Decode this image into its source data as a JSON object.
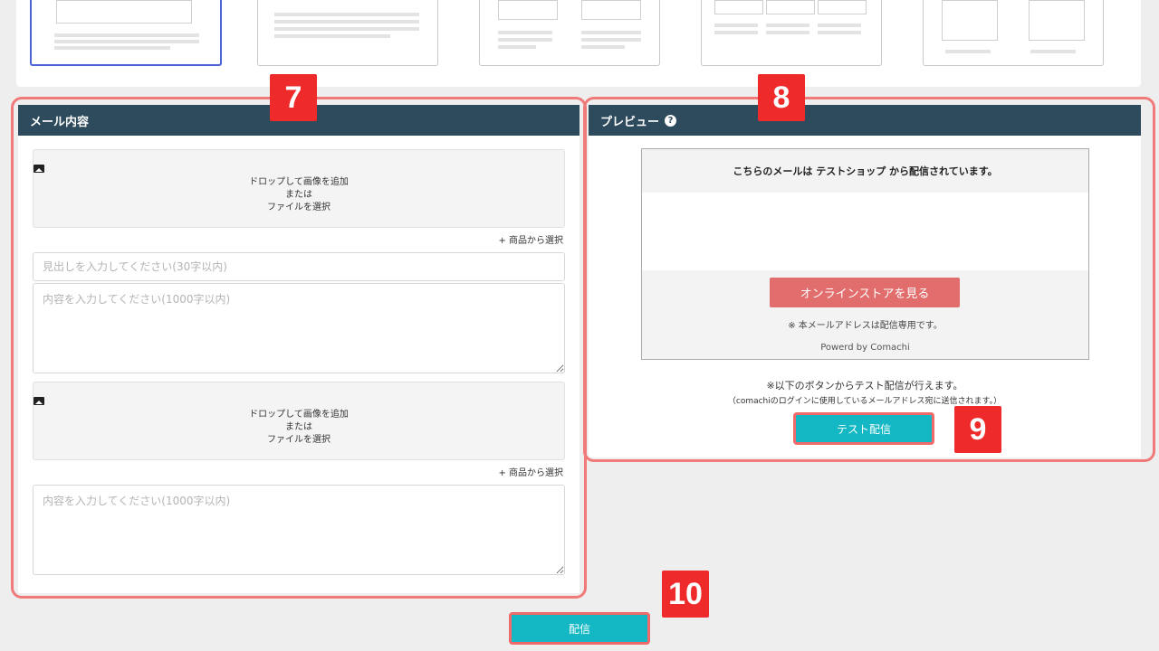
{
  "templates": [
    {
      "name": "template-1",
      "selected": true
    },
    {
      "name": "template-2",
      "selected": false
    },
    {
      "name": "template-3",
      "selected": false
    },
    {
      "name": "template-4",
      "selected": false
    },
    {
      "name": "template-5",
      "selected": false
    }
  ],
  "mail_panel": {
    "title": "メール内容",
    "drop_line1": "ドロップして画像を追加",
    "drop_line2": "または",
    "drop_line3": "ファイルを選択",
    "pick_product": "+ 商品から選択",
    "headline_placeholder": "見出しを入力してください(30字以内)",
    "content_placeholder": "内容を入力してください(1000字以内)"
  },
  "preview_panel": {
    "title": "プレビュー",
    "sender_text": "こちらのメールは テストショップ から配信されています。",
    "store_button": "オンラインストアを見る",
    "note": "※ 本メールアドレスは配信専用です。",
    "powered": "Powerd by Comachi",
    "test_note_1": "※以下のボタンからテスト配信が行えます。",
    "test_note_2": "（comachiのログインに使用しているメールアドレス宛に送信されます。）",
    "test_button": "テスト配信"
  },
  "send_button": "配信",
  "markers": [
    "7",
    "8",
    "9",
    "10"
  ],
  "colors": {
    "header": "#2e4a5d",
    "accent": "#14b8c4",
    "store_button": "#e26d6d",
    "marker": "#ef2a2a",
    "selected_border": "#4a63d6"
  }
}
